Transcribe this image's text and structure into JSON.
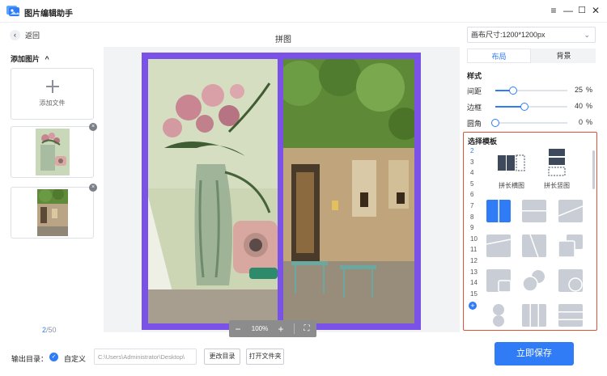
{
  "app": {
    "title": "图片编辑助手"
  },
  "window_controls": {
    "menu": "≡",
    "minimize": "—",
    "maximize": "☐",
    "close": "✕"
  },
  "left": {
    "back_label": "返回",
    "add_images_title": "添加图片",
    "add_images_chevron": "^",
    "add_file_label": "添加文件",
    "page_current": "2",
    "page_total": "/50"
  },
  "canvas": {
    "title": "拼图",
    "zoom_minus": "−",
    "zoom_value": "100%",
    "zoom_plus": "+",
    "fit_icon": "⛶"
  },
  "bottom": {
    "output_label": "输出目录：",
    "custom_label": "自定义",
    "path_value": "C:\\Users\\Administrator\\Desktop\\",
    "change_dir_label": "更改目录",
    "open_folder_label": "打开文件夹",
    "save_label": "立即保存"
  },
  "right": {
    "canvas_size_value": "画布尺寸:1200*1200px",
    "tabs": [
      {
        "label": "布局",
        "active": true
      },
      {
        "label": "背景",
        "active": false
      }
    ],
    "style_title": "样式",
    "sliders": [
      {
        "label": "间距",
        "value": "25",
        "unit": "%",
        "fraction": 0.25
      },
      {
        "label": "边框",
        "value": "40",
        "unit": "%",
        "fraction": 0.4
      },
      {
        "label": "圆角",
        "value": "0",
        "unit": "%",
        "fraction": 0.0
      }
    ],
    "templates_title": "选择模板",
    "template_counts": [
      "2",
      "3",
      "4",
      "5",
      "6",
      "7",
      "8",
      "9",
      "10",
      "11",
      "12",
      "13",
      "14",
      "15"
    ],
    "selected_count": "2",
    "add_count": "+",
    "template_long_h": "拼长横图",
    "template_long_v": "拼长竖图"
  },
  "colors": {
    "accent": "#2f7cf6",
    "collage_border": "#7b52e8",
    "highlight": "#e0503a"
  }
}
